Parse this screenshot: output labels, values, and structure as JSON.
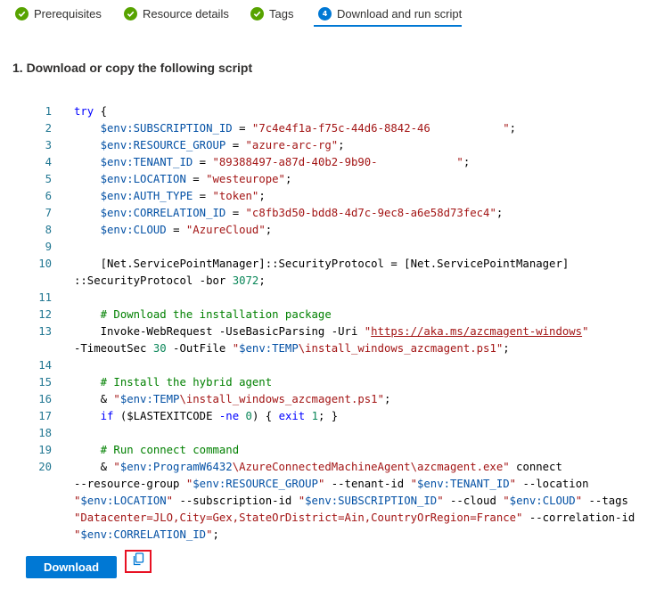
{
  "tabs": [
    {
      "label": "Prerequisites",
      "state": "complete"
    },
    {
      "label": "Resource details",
      "state": "complete"
    },
    {
      "label": "Tags",
      "state": "complete"
    },
    {
      "label": "Download and run script",
      "state": "current",
      "step": "4"
    }
  ],
  "section": {
    "title": "1. Download or copy the following script"
  },
  "script": {
    "lines": [
      {
        "n": "1",
        "parts": [
          [
            "kw",
            "try"
          ],
          [
            "",
            " {"
          ]
        ]
      },
      {
        "n": "2",
        "parts": [
          [
            "",
            "    "
          ],
          [
            "vr",
            "$env:SUBSCRIPTION_ID"
          ],
          [
            "",
            " = "
          ],
          [
            "str",
            "\"7c4e4f1a-f75c-44d6-8842-46           \""
          ],
          [
            "",
            ";"
          ]
        ]
      },
      {
        "n": "3",
        "parts": [
          [
            "",
            "    "
          ],
          [
            "vr",
            "$env:RESOURCE_GROUP"
          ],
          [
            "",
            " = "
          ],
          [
            "str",
            "\"azure-arc-rg\""
          ],
          [
            "",
            ";"
          ]
        ]
      },
      {
        "n": "4",
        "parts": [
          [
            "",
            "    "
          ],
          [
            "vr",
            "$env:TENANT_ID"
          ],
          [
            "",
            " = "
          ],
          [
            "str",
            "\"89388497-a87d-40b2-9b90-            \""
          ],
          [
            "",
            ";"
          ]
        ]
      },
      {
        "n": "5",
        "parts": [
          [
            "",
            "    "
          ],
          [
            "vr",
            "$env:LOCATION"
          ],
          [
            "",
            " = "
          ],
          [
            "str",
            "\"westeurope\""
          ],
          [
            "",
            ";"
          ]
        ]
      },
      {
        "n": "6",
        "parts": [
          [
            "",
            "    "
          ],
          [
            "vr",
            "$env:AUTH_TYPE"
          ],
          [
            "",
            " = "
          ],
          [
            "str",
            "\"token\""
          ],
          [
            "",
            ";"
          ]
        ]
      },
      {
        "n": "7",
        "parts": [
          [
            "",
            "    "
          ],
          [
            "vr",
            "$env:CORRELATION_ID"
          ],
          [
            "",
            " = "
          ],
          [
            "str",
            "\"c8fb3d50-bdd8-4d7c-9ec8-a6e58d73fec4\""
          ],
          [
            "",
            ";"
          ]
        ]
      },
      {
        "n": "8",
        "parts": [
          [
            "",
            "    "
          ],
          [
            "vr",
            "$env:CLOUD"
          ],
          [
            "",
            " = "
          ],
          [
            "str",
            "\"AzureCloud\""
          ],
          [
            "",
            ";"
          ]
        ]
      },
      {
        "n": "9",
        "parts": []
      },
      {
        "n": "10",
        "parts": [
          [
            "",
            "    [Net.ServicePointManager]::SecurityProtocol = [Net.ServicePointManager]"
          ]
        ]
      },
      {
        "n": "",
        "parts": [
          [
            "",
            "::SecurityProtocol -bor "
          ],
          [
            "num",
            "3072"
          ],
          [
            "",
            ";"
          ]
        ]
      },
      {
        "n": "11",
        "parts": []
      },
      {
        "n": "12",
        "parts": [
          [
            "",
            "    "
          ],
          [
            "cm",
            "# Download the installation package"
          ]
        ]
      },
      {
        "n": "13",
        "parts": [
          [
            "",
            "    Invoke-WebRequest -UseBasicParsing -Uri "
          ],
          [
            "str",
            "\""
          ],
          [
            "url",
            "https://aka.ms/azcmagent-windows"
          ],
          [
            "str",
            "\""
          ]
        ]
      },
      {
        "n": "",
        "parts": [
          [
            "",
            "-TimeoutSec "
          ],
          [
            "num",
            "30"
          ],
          [
            "",
            " -OutFile "
          ],
          [
            "str",
            "\""
          ],
          [
            "vr",
            "$env:TEMP"
          ],
          [
            "str",
            "\\install_windows_azcmagent.ps1\""
          ],
          [
            "",
            ";"
          ]
        ]
      },
      {
        "n": "14",
        "parts": []
      },
      {
        "n": "15",
        "parts": [
          [
            "",
            "    "
          ],
          [
            "cm",
            "# Install the hybrid agent"
          ]
        ]
      },
      {
        "n": "16",
        "parts": [
          [
            "",
            "    & "
          ],
          [
            "str",
            "\""
          ],
          [
            "vr",
            "$env:TEMP"
          ],
          [
            "str",
            "\\install_windows_azcmagent.ps1\""
          ],
          [
            "",
            ";"
          ]
        ]
      },
      {
        "n": "17",
        "parts": [
          [
            "",
            "    "
          ],
          [
            "kw",
            "if"
          ],
          [
            "",
            " ($LASTEXITCODE "
          ],
          [
            "kw",
            "-ne"
          ],
          [
            "",
            " "
          ],
          [
            "num",
            "0"
          ],
          [
            "",
            ") { "
          ],
          [
            "kw",
            "exit"
          ],
          [
            "",
            " "
          ],
          [
            "num",
            "1"
          ],
          [
            "",
            "; }"
          ]
        ]
      },
      {
        "n": "18",
        "parts": []
      },
      {
        "n": "19",
        "parts": [
          [
            "",
            "    "
          ],
          [
            "cm",
            "# Run connect command"
          ]
        ]
      },
      {
        "n": "20",
        "parts": [
          [
            "",
            "    & "
          ],
          [
            "str",
            "\""
          ],
          [
            "vr",
            "$env:ProgramW6432"
          ],
          [
            "str",
            "\\AzureConnectedMachineAgent\\azcmagent.exe\""
          ],
          [
            "",
            " connect"
          ]
        ]
      },
      {
        "n": "",
        "parts": [
          [
            "",
            "--resource-group "
          ],
          [
            "str",
            "\""
          ],
          [
            "vr",
            "$env:RESOURCE_GROUP"
          ],
          [
            "str",
            "\""
          ],
          [
            "",
            " --tenant-id "
          ],
          [
            "str",
            "\""
          ],
          [
            "vr",
            "$env:TENANT_ID"
          ],
          [
            "str",
            "\""
          ],
          [
            "",
            " --location"
          ]
        ]
      },
      {
        "n": "",
        "parts": [
          [
            "str",
            "\""
          ],
          [
            "vr",
            "$env:LOCATION"
          ],
          [
            "str",
            "\""
          ],
          [
            "",
            " --subscription-id "
          ],
          [
            "str",
            "\""
          ],
          [
            "vr",
            "$env:SUBSCRIPTION_ID"
          ],
          [
            "str",
            "\""
          ],
          [
            "",
            " --cloud "
          ],
          [
            "str",
            "\""
          ],
          [
            "vr",
            "$env:CLOUD"
          ],
          [
            "str",
            "\""
          ],
          [
            "",
            " --tags"
          ]
        ]
      },
      {
        "n": "",
        "parts": [
          [
            "str",
            "\"Datacenter=JLO,City=Gex,StateOrDistrict=Ain,CountryOrRegion=France\""
          ],
          [
            "",
            " --correlation-id"
          ]
        ]
      },
      {
        "n": "",
        "parts": [
          [
            "str",
            "\""
          ],
          [
            "vr",
            "$env:CORRELATION_ID"
          ],
          [
            "str",
            "\""
          ],
          [
            "",
            ";"
          ]
        ]
      }
    ]
  },
  "actions": {
    "download_label": "Download",
    "copy_icon": "copy-icon"
  },
  "colors": {
    "accent": "#0078d4",
    "success": "#57a300",
    "highlight_border": "#e81123"
  }
}
